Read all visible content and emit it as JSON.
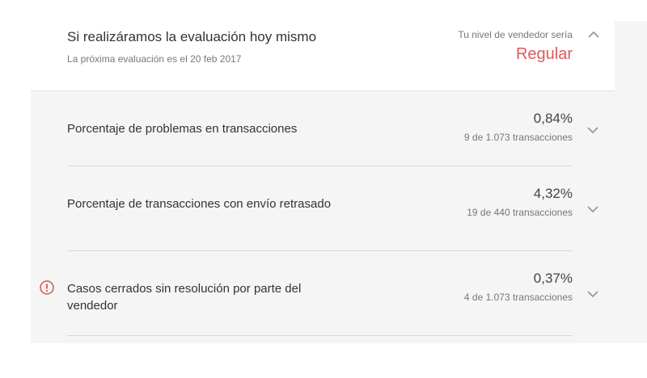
{
  "header": {
    "title": "Si realizáramos la evaluación hoy mismo",
    "subtitle": "La próxima evaluación es el 20 feb 2017",
    "level_label": "Tu nivel de vendedor sería",
    "level_value": "Regular",
    "toggle_icon": "chevron-up-icon"
  },
  "metrics": [
    {
      "label": "Porcentaje de problemas en transacciones",
      "value": "0,84%",
      "count": "9 de 1.073 transacciones",
      "expand_icon": "chevron-down-icon",
      "alert": false
    },
    {
      "label": "Porcentaje de transacciones con envío retrasado",
      "value": "4,32%",
      "count": "19 de 440 transacciones",
      "expand_icon": "chevron-down-icon",
      "alert": false
    },
    {
      "label": "Casos cerrados sin resolución por parte del vendedor",
      "value": "0,37%",
      "count": "4 de 1.073 transacciones",
      "expand_icon": "chevron-down-icon",
      "alert": true,
      "alert_icon": "alert-circle-icon"
    }
  ],
  "colors": {
    "level_accent": "#dd5b5b",
    "alert_icon": "#d9534f",
    "metrics_background": "#f5f5f5"
  }
}
